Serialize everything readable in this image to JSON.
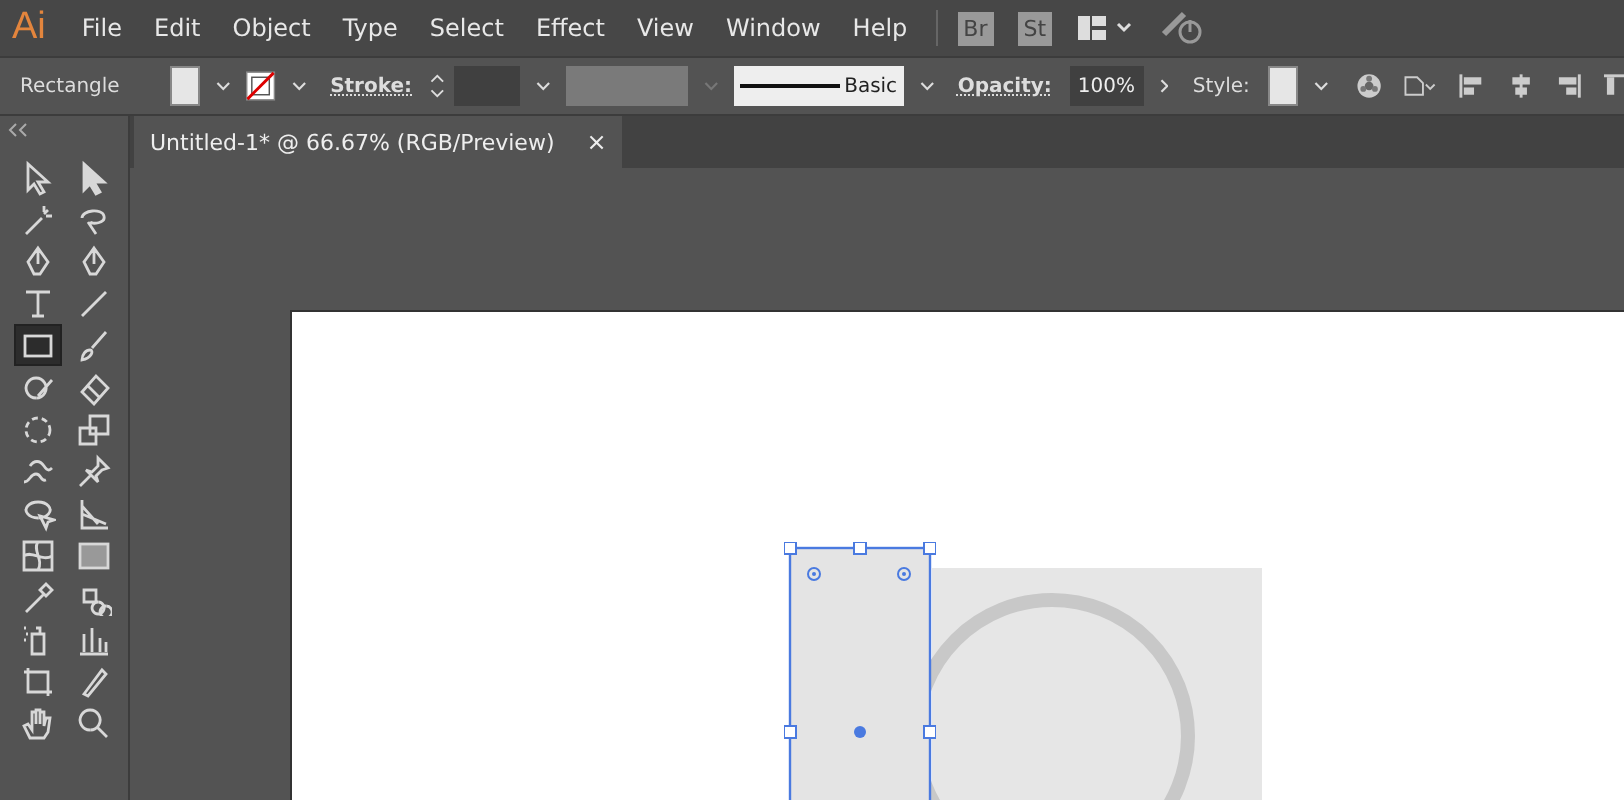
{
  "app": {
    "logo": "Ai"
  },
  "menu": [
    "File",
    "Edit",
    "Object",
    "Type",
    "Select",
    "Effect",
    "View",
    "Window",
    "Help"
  ],
  "menu_buttons": [
    "Br",
    "St"
  ],
  "control_bar": {
    "tool_label": "Rectangle",
    "stroke_label": "Stroke:",
    "brush": "Basic",
    "opacity_label": "Opacity:",
    "opacity": "100%",
    "style_label": "Style:"
  },
  "tabs": [
    {
      "title": "Untitled-1* @ 66.67% (RGB/Preview)",
      "close": "×",
      "selected": true
    }
  ],
  "tools": [
    {
      "selected": false
    },
    {
      "selected": false
    },
    {
      "selected": false
    },
    {
      "selected": false
    },
    {
      "selected": false
    },
    {
      "selected": false
    },
    {
      "selected": false
    },
    {
      "selected": false
    },
    {
      "selected": true
    },
    {
      "selected": false
    },
    {
      "selected": false
    },
    {
      "selected": false
    },
    {
      "selected": false
    },
    {
      "selected": false
    },
    {
      "selected": false
    },
    {
      "selected": false
    },
    {
      "selected": false
    },
    {
      "selected": false
    },
    {
      "selected": false
    },
    {
      "selected": false
    },
    {
      "selected": false
    },
    {
      "selected": false
    },
    {
      "selected": false
    },
    {
      "selected": false
    },
    {
      "selected": false
    },
    {
      "selected": false
    },
    {
      "selected": false
    },
    {
      "selected": false
    }
  ]
}
